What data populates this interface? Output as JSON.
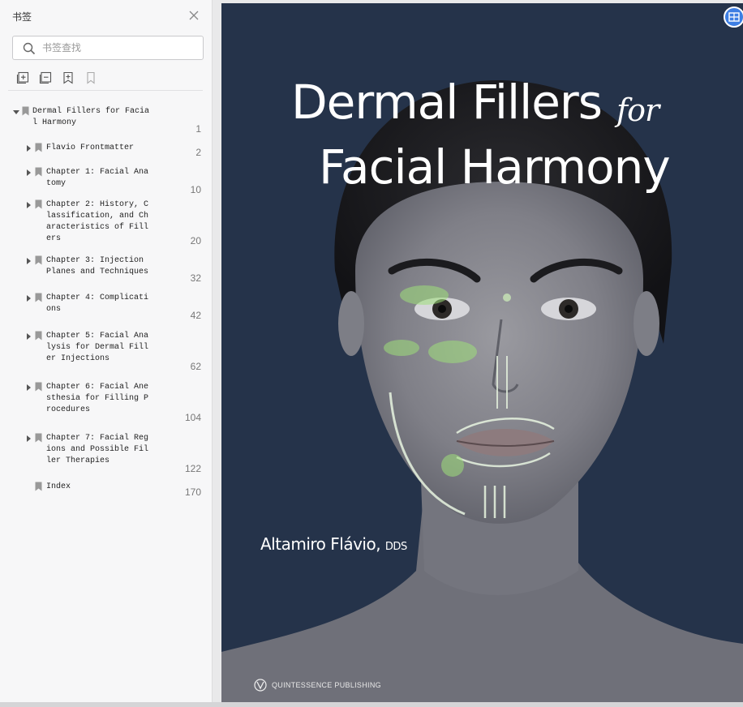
{
  "sidebar": {
    "title": "书签",
    "search_placeholder": "书签查找",
    "bookmarks": [
      {
        "label": "Dermal Fillers for Facia\nl Harmony",
        "page": "1",
        "expanded": true
      },
      {
        "label": "Flavio Frontmatter",
        "page": "2"
      },
      {
        "label": "Chapter 1: Facial Ana\ntomy",
        "page": "10"
      },
      {
        "label": "Chapter 2: History, C\nlassification, and Ch\naracteristics of Fill\ners",
        "page": "20"
      },
      {
        "label": "Chapter 3: Injection\nPlanes and Techniques",
        "page": "32"
      },
      {
        "label": "Chapter 4: Complicati\nons",
        "page": "42"
      },
      {
        "label": "Chapter 5: Facial Ana\nlysis for Dermal Fill\ner Injections",
        "page": "62"
      },
      {
        "label": "Chapter 6: Facial Ane\nsthesia for Filling P\nrocedures",
        "page": "104"
      },
      {
        "label": "Chapter 7: Facial Reg\nions and Possible Fil\nler Therapies",
        "page": "122"
      },
      {
        "label": "Index",
        "page": "170"
      }
    ]
  },
  "cover": {
    "title_line1": "Dermal Fillers",
    "title_for": "for",
    "title_line2": "Facial Harmony",
    "author": "Altamiro Flávio,",
    "author_suffix": "DDS",
    "publisher": "QUINTESSENCE PUBLISHING"
  },
  "colors": {
    "cover_background": "#25334a",
    "accent_green": "#9fe07a",
    "toggle_blue": "#3d7ee3"
  }
}
